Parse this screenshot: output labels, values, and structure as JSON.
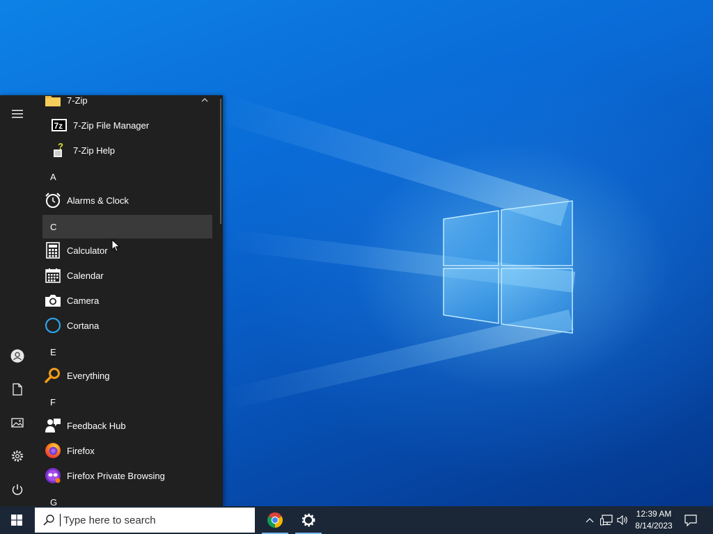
{
  "start_menu": {
    "rail": {
      "menu_icon": "hamburger-icon",
      "bottom_icons": [
        "user-icon",
        "documents-icon",
        "pictures-icon",
        "settings-icon",
        "power-icon"
      ]
    },
    "items": [
      {
        "type": "app",
        "label": "7-Zip",
        "icon": "folder-icon"
      },
      {
        "type": "app",
        "label": "7-Zip File Manager",
        "icon": "7zip-icon"
      },
      {
        "type": "app",
        "label": "7-Zip Help",
        "icon": "help-icon"
      },
      {
        "type": "letter",
        "label": "A"
      },
      {
        "type": "app",
        "label": "Alarms & Clock",
        "icon": "alarm-clock-icon"
      },
      {
        "type": "letter",
        "label": "C"
      },
      {
        "type": "app",
        "label": "Calculator",
        "icon": "calculator-icon"
      },
      {
        "type": "app",
        "label": "Calendar",
        "icon": "calendar-icon"
      },
      {
        "type": "app",
        "label": "Camera",
        "icon": "camera-icon"
      },
      {
        "type": "app",
        "label": "Cortana",
        "icon": "cortana-icon"
      },
      {
        "type": "letter",
        "label": "E"
      },
      {
        "type": "app",
        "label": "Everything",
        "icon": "everything-search-icon"
      },
      {
        "type": "letter",
        "label": "F"
      },
      {
        "type": "app",
        "label": "Feedback Hub",
        "icon": "feedback-hub-icon"
      },
      {
        "type": "app",
        "label": "Firefox",
        "icon": "firefox-icon"
      },
      {
        "type": "app",
        "label": "Firefox Private Browsing",
        "icon": "firefox-private-icon"
      },
      {
        "type": "letter",
        "label": "G"
      }
    ]
  },
  "taskbar": {
    "search_placeholder": "Type here to search",
    "pinned_apps": [
      "chrome-icon",
      "settings-icon"
    ],
    "clock": {
      "time": "12:39 AM",
      "date": "8/14/2023"
    },
    "accent_color": "#76b9ed"
  }
}
